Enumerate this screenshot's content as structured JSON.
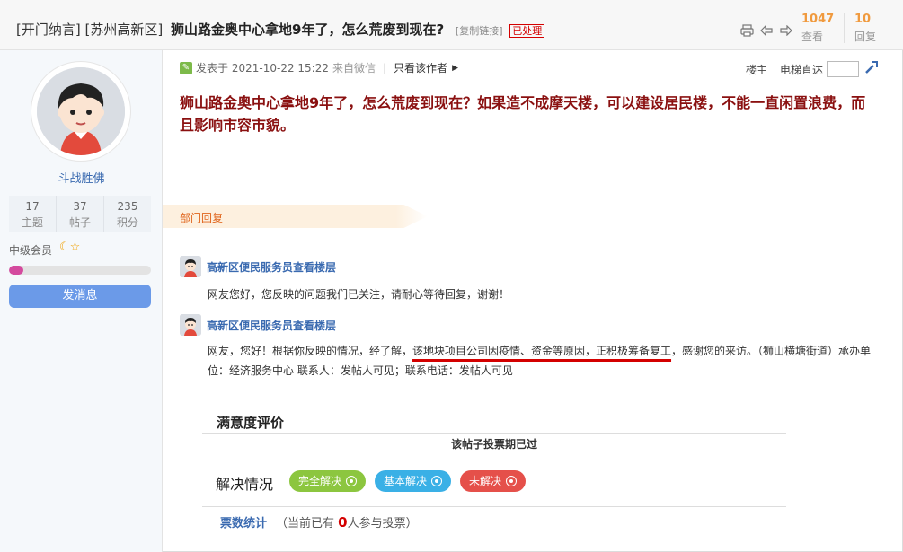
{
  "header": {
    "tag1": "[开门纳言]",
    "tag2": "[苏州高新区]",
    "title": "狮山路金奥中心拿地9年了，怎么荒废到现在?",
    "copy_link": "[复制链接]",
    "status": "已处理",
    "views": "1047",
    "views_label": "查看",
    "replies": "10",
    "replies_label": "回复",
    "icons": [
      "print-icon",
      "prev-icon",
      "next-icon"
    ]
  },
  "sidebar": {
    "username": "斗战胜佛",
    "stats": [
      {
        "value": "17",
        "label": "主题"
      },
      {
        "value": "37",
        "label": "帖子"
      },
      {
        "value": "235",
        "label": "积分"
      }
    ],
    "level": "中级会员",
    "level_progress": 0.1,
    "message_button": "发消息"
  },
  "post": {
    "posted_label": "发表于",
    "datetime": "2021-10-22 15:22",
    "source": "来自微信",
    "only_author": "只看该作者",
    "floor_owner": "楼主",
    "elevator": "电梯直达",
    "content": "狮山路金奥中心拿地9年了，怎么荒废到现在？如果造不成摩天楼，可以建设居民楼，不能一直闲置浪费，而且影响市容市貌。"
  },
  "dept": {
    "label": "部门回复"
  },
  "replies": [
    {
      "name": "高新区便民服务员查看楼层",
      "text": "网友您好，您反映的问题我们已关注，请耐心等待回复，谢谢！"
    },
    {
      "name": "高新区便民服务员查看楼层",
      "text_before": "网友，您好！根据你反映的情况，经了解，",
      "text_highlight": "该地块项目公司因疫情、资金等原因，正积极筹备复工",
      "text_after": "，感谢您的来访。（狮山横塘街道）承办单位：经济服务中心 联系人：发帖人可见；联系电话：发帖人可见"
    }
  ],
  "rating": {
    "title": "满意度评价",
    "closed": "该帖子投票期已过",
    "resolve_title": "解决情况",
    "options": [
      {
        "label": "完全解决",
        "color": "#8cc63f"
      },
      {
        "label": "基本解决",
        "color": "#3ab0e6"
      },
      {
        "label": "未解决",
        "color": "#e5504a"
      }
    ],
    "votes_label": "票数统计",
    "votes_prefix": "（当前已有",
    "votes_count": "0",
    "votes_suffix": "人参与投票）"
  }
}
